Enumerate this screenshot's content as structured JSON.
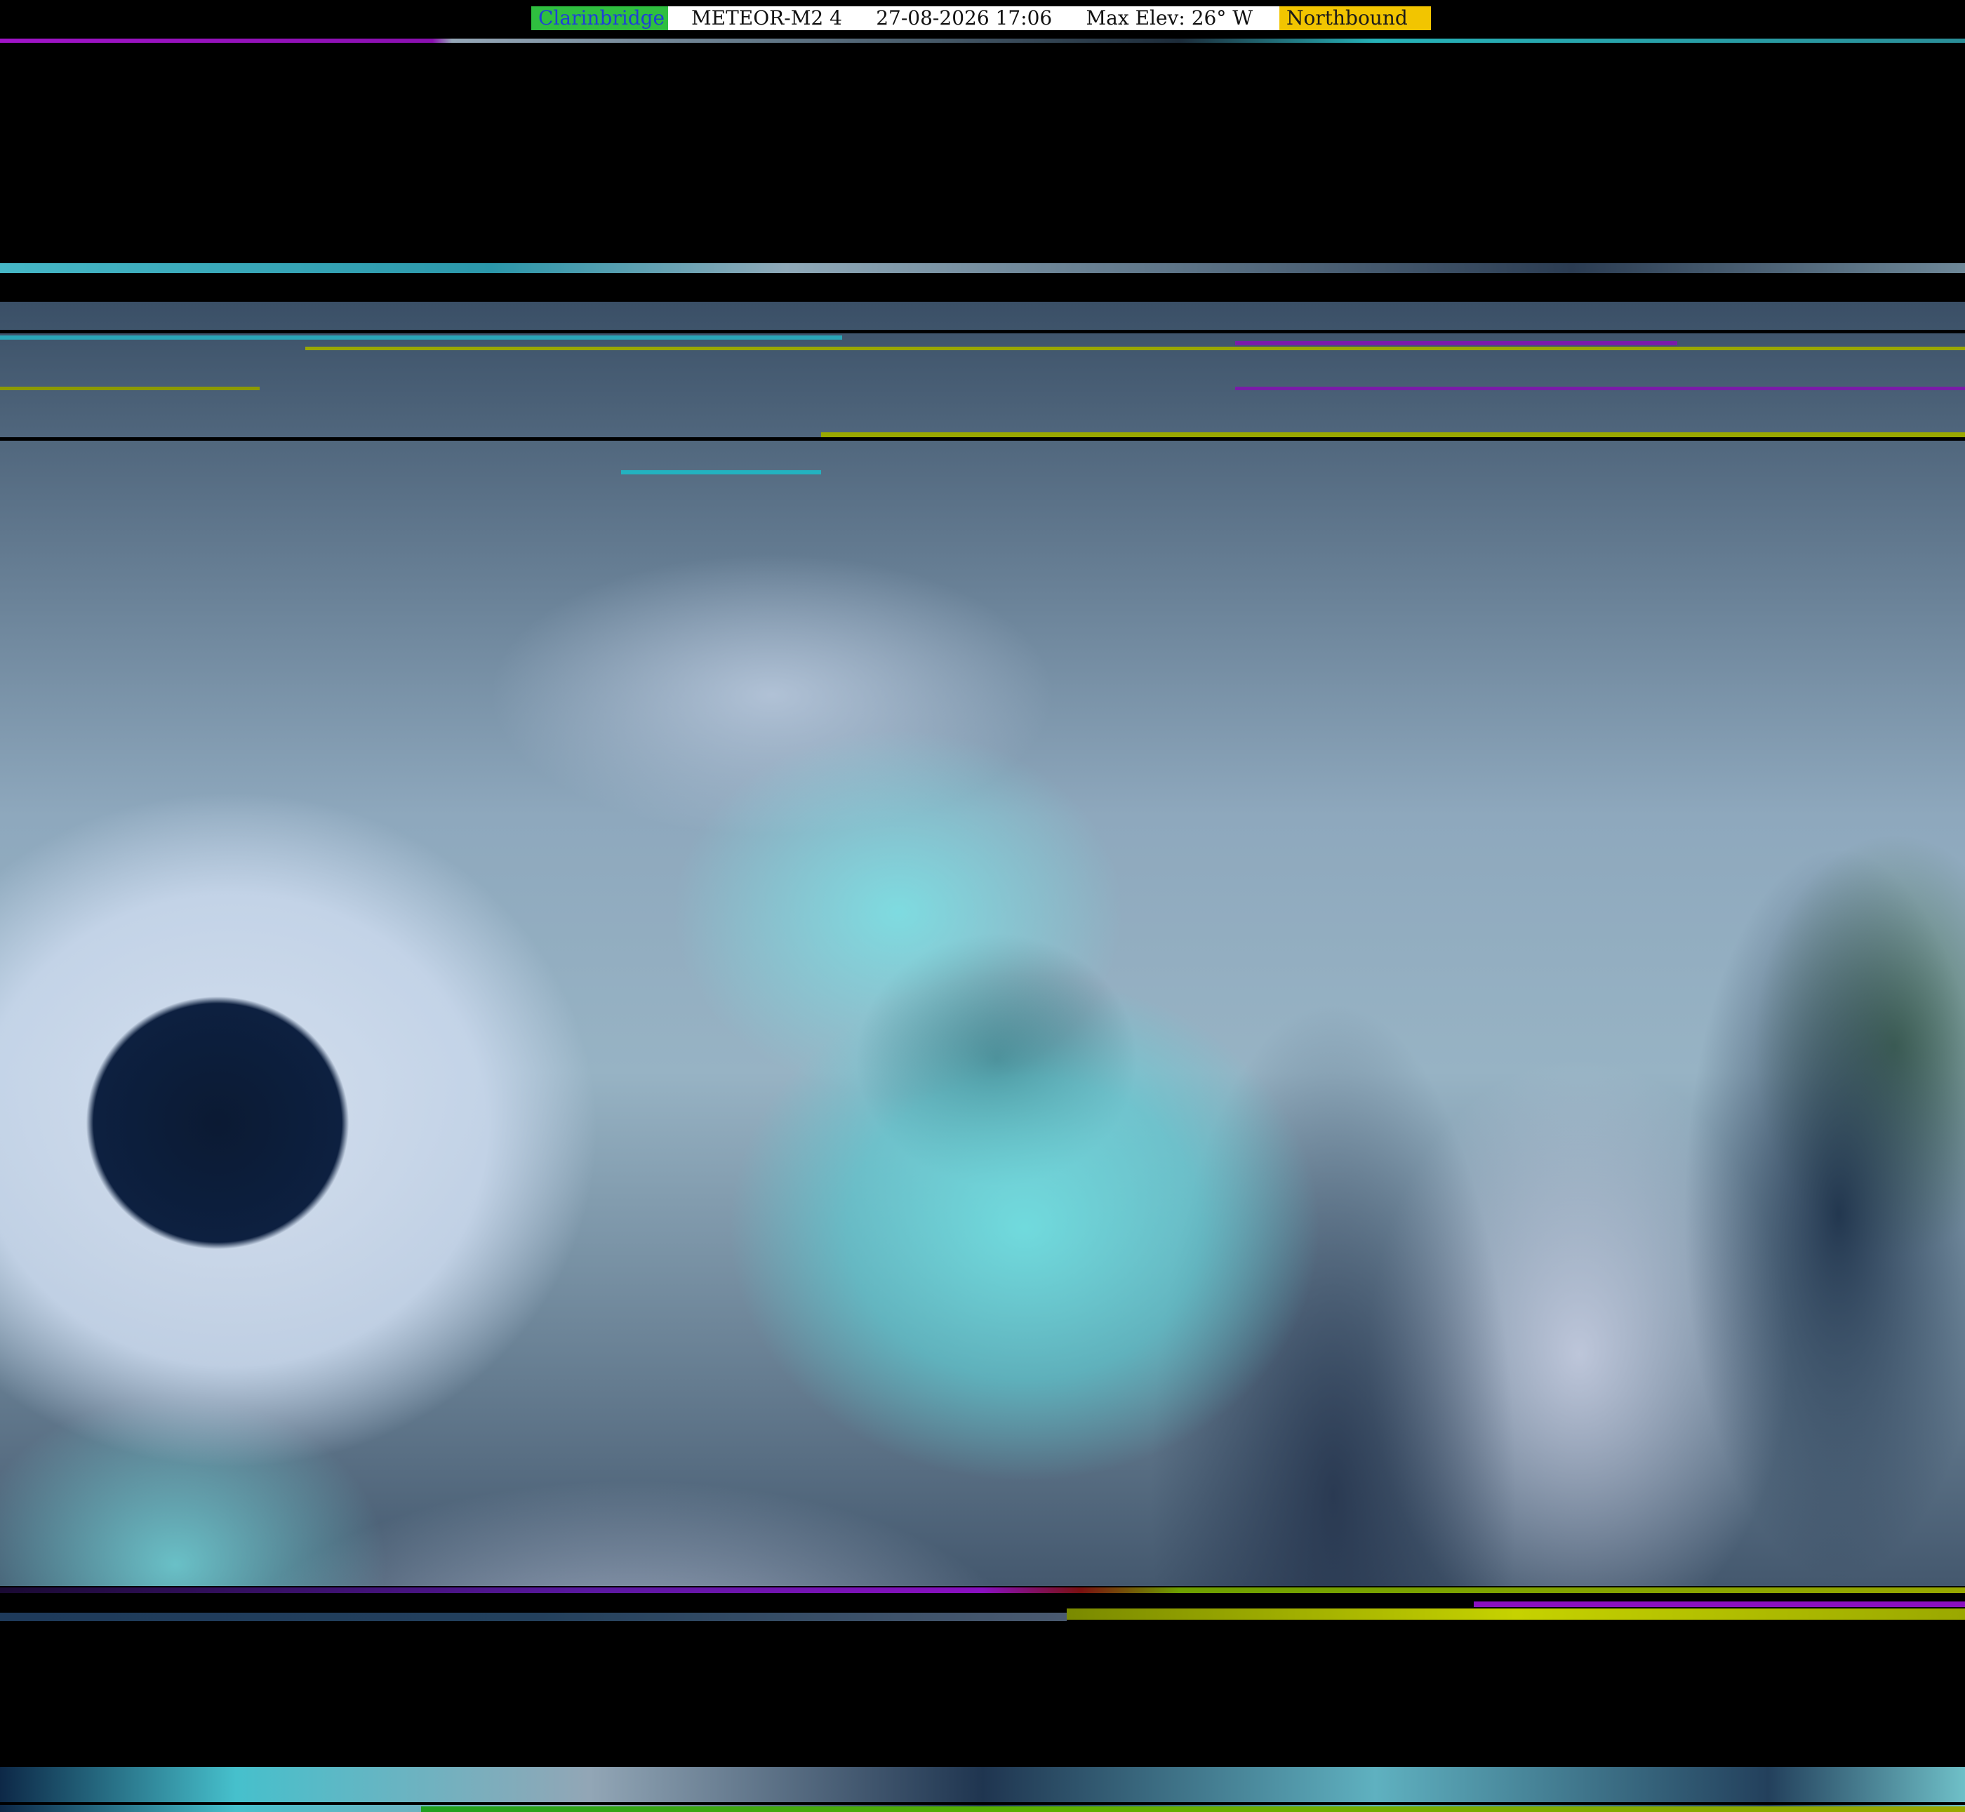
{
  "header": {
    "station": "Clarinbridge",
    "satellite": "METEOR-M2 4",
    "datetime": "27-08-2026 17:06",
    "max_elev": "Max Elev: 26° W",
    "direction": "Northbound"
  },
  "colors": {
    "station_bg": "#2fbf3f",
    "station_text": "#1f3fd8",
    "direction_bg": "#f2c500",
    "direction_text": "#1a1a1a",
    "info_bg": "#ffffff"
  }
}
